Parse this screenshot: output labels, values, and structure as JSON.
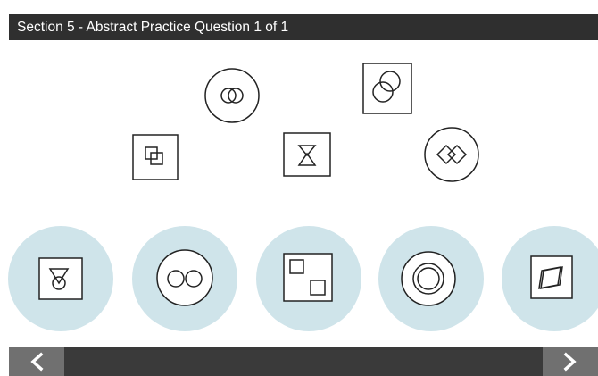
{
  "header": {
    "title": "Section 5 - Abstract Practice Question 1 of 1"
  },
  "question_shapes": [
    {
      "name": "interlocking-rings-circle-figure"
    },
    {
      "name": "overlapping-circles-square-figure"
    },
    {
      "name": "overlapping-squares-square-figure"
    },
    {
      "name": "hourglass-square-figure"
    },
    {
      "name": "interlocking-diamonds-circle-figure"
    }
  ],
  "answer_options": [
    {
      "name": "triangle-circle-square-figure"
    },
    {
      "name": "two-circles-circle-figure"
    },
    {
      "name": "two-squares-square-figure"
    },
    {
      "name": "concentric-circles-figure"
    },
    {
      "name": "overlapping-parallelograms-figure"
    }
  ],
  "navigation": {
    "prev_icon": "chevron-left-icon",
    "next_icon": "chevron-right-icon"
  },
  "colors": {
    "title_bar": "#2f2f2f",
    "nav_bar": "#3a3a3a",
    "nav_button": "#707070",
    "option_circle": "#cfe4ea",
    "stroke": "#222222"
  }
}
